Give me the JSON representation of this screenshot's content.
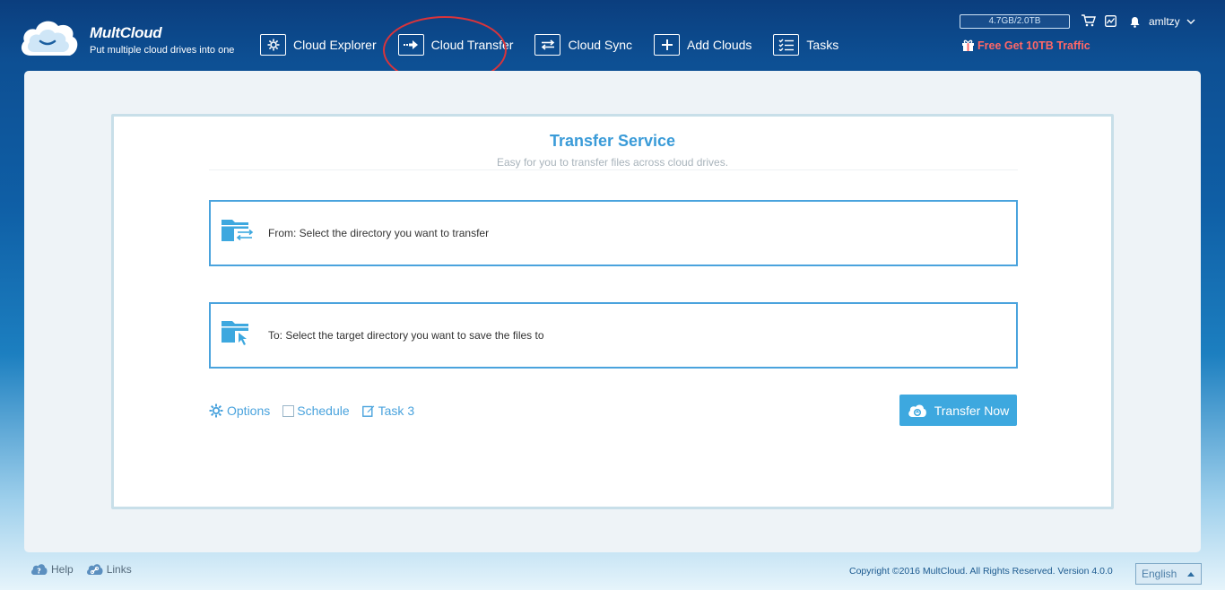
{
  "header": {
    "brand": "MultCloud",
    "tagline": "Put multiple cloud drives into one"
  },
  "nav": [
    {
      "label": "Cloud Explorer",
      "icon": "gear-folder-icon"
    },
    {
      "label": "Cloud Transfer",
      "icon": "transfer-arrow-icon",
      "active": true
    },
    {
      "label": "Cloud Sync",
      "icon": "sync-arrows-icon"
    },
    {
      "label": "Add Clouds",
      "icon": "plus-icon"
    },
    {
      "label": "Tasks",
      "icon": "checklist-icon"
    }
  ],
  "topbar": {
    "traffic": "4.7GB/2.0TB",
    "username": "amltzy",
    "promo": "Free Get 10TB Traffic"
  },
  "card": {
    "title": "Transfer Service",
    "subtitle": "Easy for you to transfer files across cloud drives.",
    "from_label": "From: Select the directory you want to transfer",
    "to_label": "To: Select the target directory you want to save the files to",
    "options_label": "Options",
    "schedule_label": "Schedule",
    "task_label": "Task 3",
    "transfer_button": "Transfer Now"
  },
  "footer": {
    "help": "Help",
    "links": "Links",
    "copyright": "Copyright ©2016 MultCloud. All Rights Reserved. Version 4.0.0",
    "language": "English"
  },
  "colors": {
    "accent": "#3da8df",
    "highlight_ring": "#d9343b",
    "promo": "#ff6767"
  }
}
